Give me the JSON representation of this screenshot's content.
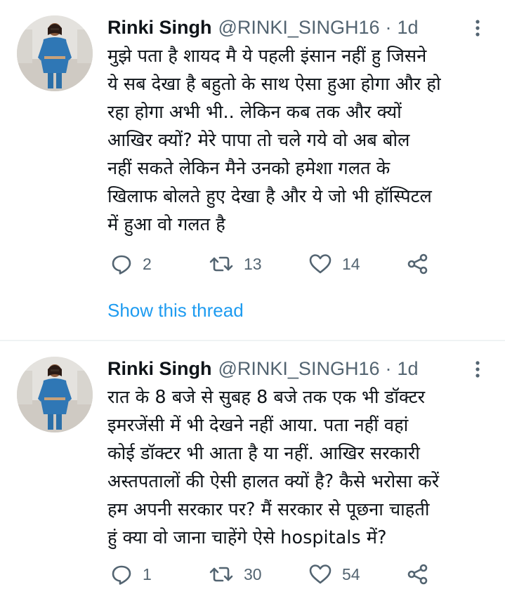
{
  "tweets": [
    {
      "author_name": "Rinki Singh",
      "author_handle": "@RINKI_SINGH16",
      "separator": "·",
      "time": "1d",
      "text": "मुझे पता है शायद मै ये पहली इंसान नहीं हु जिसने\nये सब देखा है बहुतो के साथ ऐसा हुआ होगा और हो\nरहा होगा अभी भी.. लेकिन कब तक और क्यों\nआखिर क्यों?  मेरे पापा तो चले गये वो अब बोल\nनहीं सकते लेकिन मैने उनको हमेशा गलत के\nखिलाफ बोलते हुए देखा है और ये जो भी हॉस्पिटल\nमें हुआ वो गलत है",
      "replies": "2",
      "retweets": "13",
      "likes": "14",
      "show_thread": "Show this thread"
    },
    {
      "author_name": "Rinki Singh",
      "author_handle": "@RINKI_SINGH16",
      "separator": "·",
      "time": "1d",
      "text": "रात के 8 बजे से सुबह 8 बजे तक एक भी डॉक्टर\nइमरजेंसी में भी देखने नहीं आया. पता नहीं वहां\nकोई डॉक्टर भी आता है या नहीं. आखिर सरकारी\nअस्तपतालों की ऐसी हालत क्यों है? कैसे भरोसा करें\nहम अपनी सरकार पर? मैं सरकार से पूछना चाहती\nहुं क्या वो जाना चाहेंगे ऐसे hospitals  में?",
      "replies": "1",
      "retweets": "30",
      "likes": "54"
    }
  ],
  "icons": {
    "reply": "reply-icon",
    "retweet": "retweet-icon",
    "like": "heart-icon",
    "share": "share-icon",
    "more": "more-vertical-icon"
  },
  "colors": {
    "link": "#1d9bf0",
    "secondary_text": "#536471",
    "primary_text": "#0f1419",
    "divider": "#eff3f4"
  }
}
